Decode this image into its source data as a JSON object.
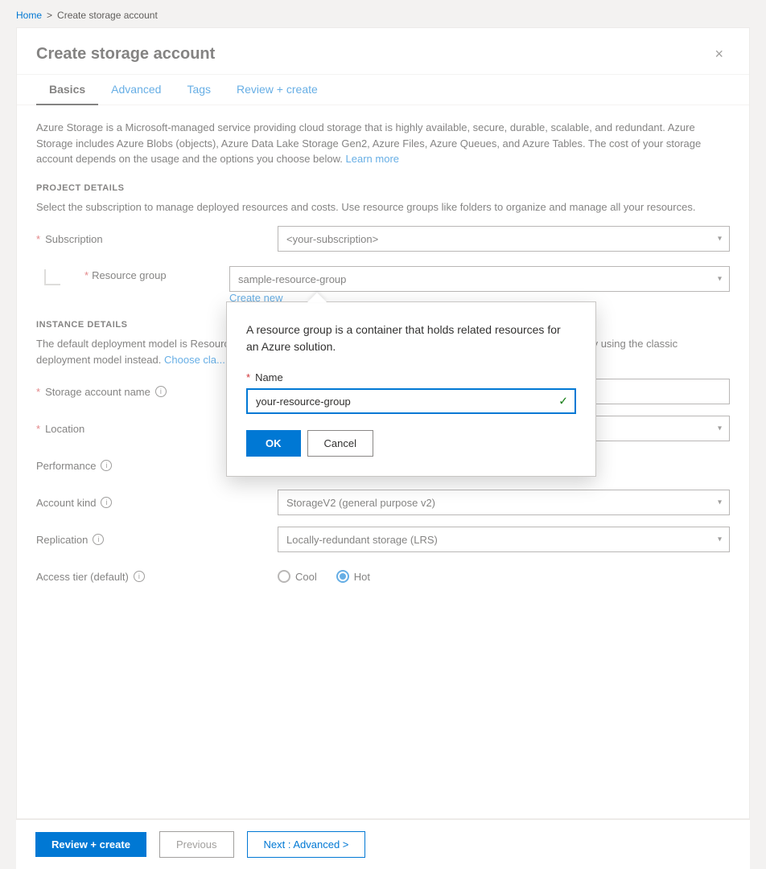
{
  "breadcrumb": {
    "home": "Home",
    "separator": ">",
    "current": "Create storage account"
  },
  "page": {
    "title": "Create storage account",
    "close_label": "×"
  },
  "tabs": [
    {
      "id": "basics",
      "label": "Basics",
      "active": true
    },
    {
      "id": "advanced",
      "label": "Advanced",
      "active": false
    },
    {
      "id": "tags",
      "label": "Tags",
      "active": false
    },
    {
      "id": "review",
      "label": "Review + create",
      "active": false
    }
  ],
  "description": "Azure Storage is a Microsoft-managed service providing cloud storage that is highly available, secure, durable, scalable, and redundant. Azure Storage includes Azure Blobs (objects), Azure Data Lake Storage Gen2, Azure Files, Azure Queues, and Azure Tables. The cost of your storage account depends on the usage and the options you choose below.",
  "learn_more": "Learn more",
  "project_details": {
    "section_title": "PROJECT DETAILS",
    "section_desc": "Select the subscription to manage deployed resources and costs. Use resource groups like folders to organize and manage all your resources.",
    "subscription_label": "Subscription",
    "subscription_value": "<your-subscription>",
    "resource_group_label": "Resource group",
    "resource_group_value": "sample-resource-group",
    "create_new": "Create new"
  },
  "instance_details": {
    "section_title": "INSTANCE DETAILS",
    "section_desc": "The default deployment model is Resource Manager, which supports the latest Azure features. You may choose to deploy using the classic deployment model instead.",
    "choose_classic": "Choose cla...",
    "storage_name_label": "Storage account name",
    "location_label": "Location",
    "performance_label": "Performance",
    "account_kind_label": "Account kind",
    "account_kind_value": "StorageV2 (general purpose v2)",
    "replication_label": "Replication",
    "replication_value": "Locally-redundant storage (LRS)",
    "access_tier_label": "Access tier (default)",
    "access_tier_options": [
      "Cool",
      "Hot"
    ],
    "access_tier_selected": "Hot"
  },
  "modal": {
    "description": "A resource group is a container that holds related resources for an Azure solution.",
    "name_label": "Name",
    "name_value": "your-resource-group",
    "ok_label": "OK",
    "cancel_label": "Cancel"
  },
  "footer": {
    "review_create": "Review + create",
    "previous": "Previous",
    "next": "Next : Advanced >"
  }
}
